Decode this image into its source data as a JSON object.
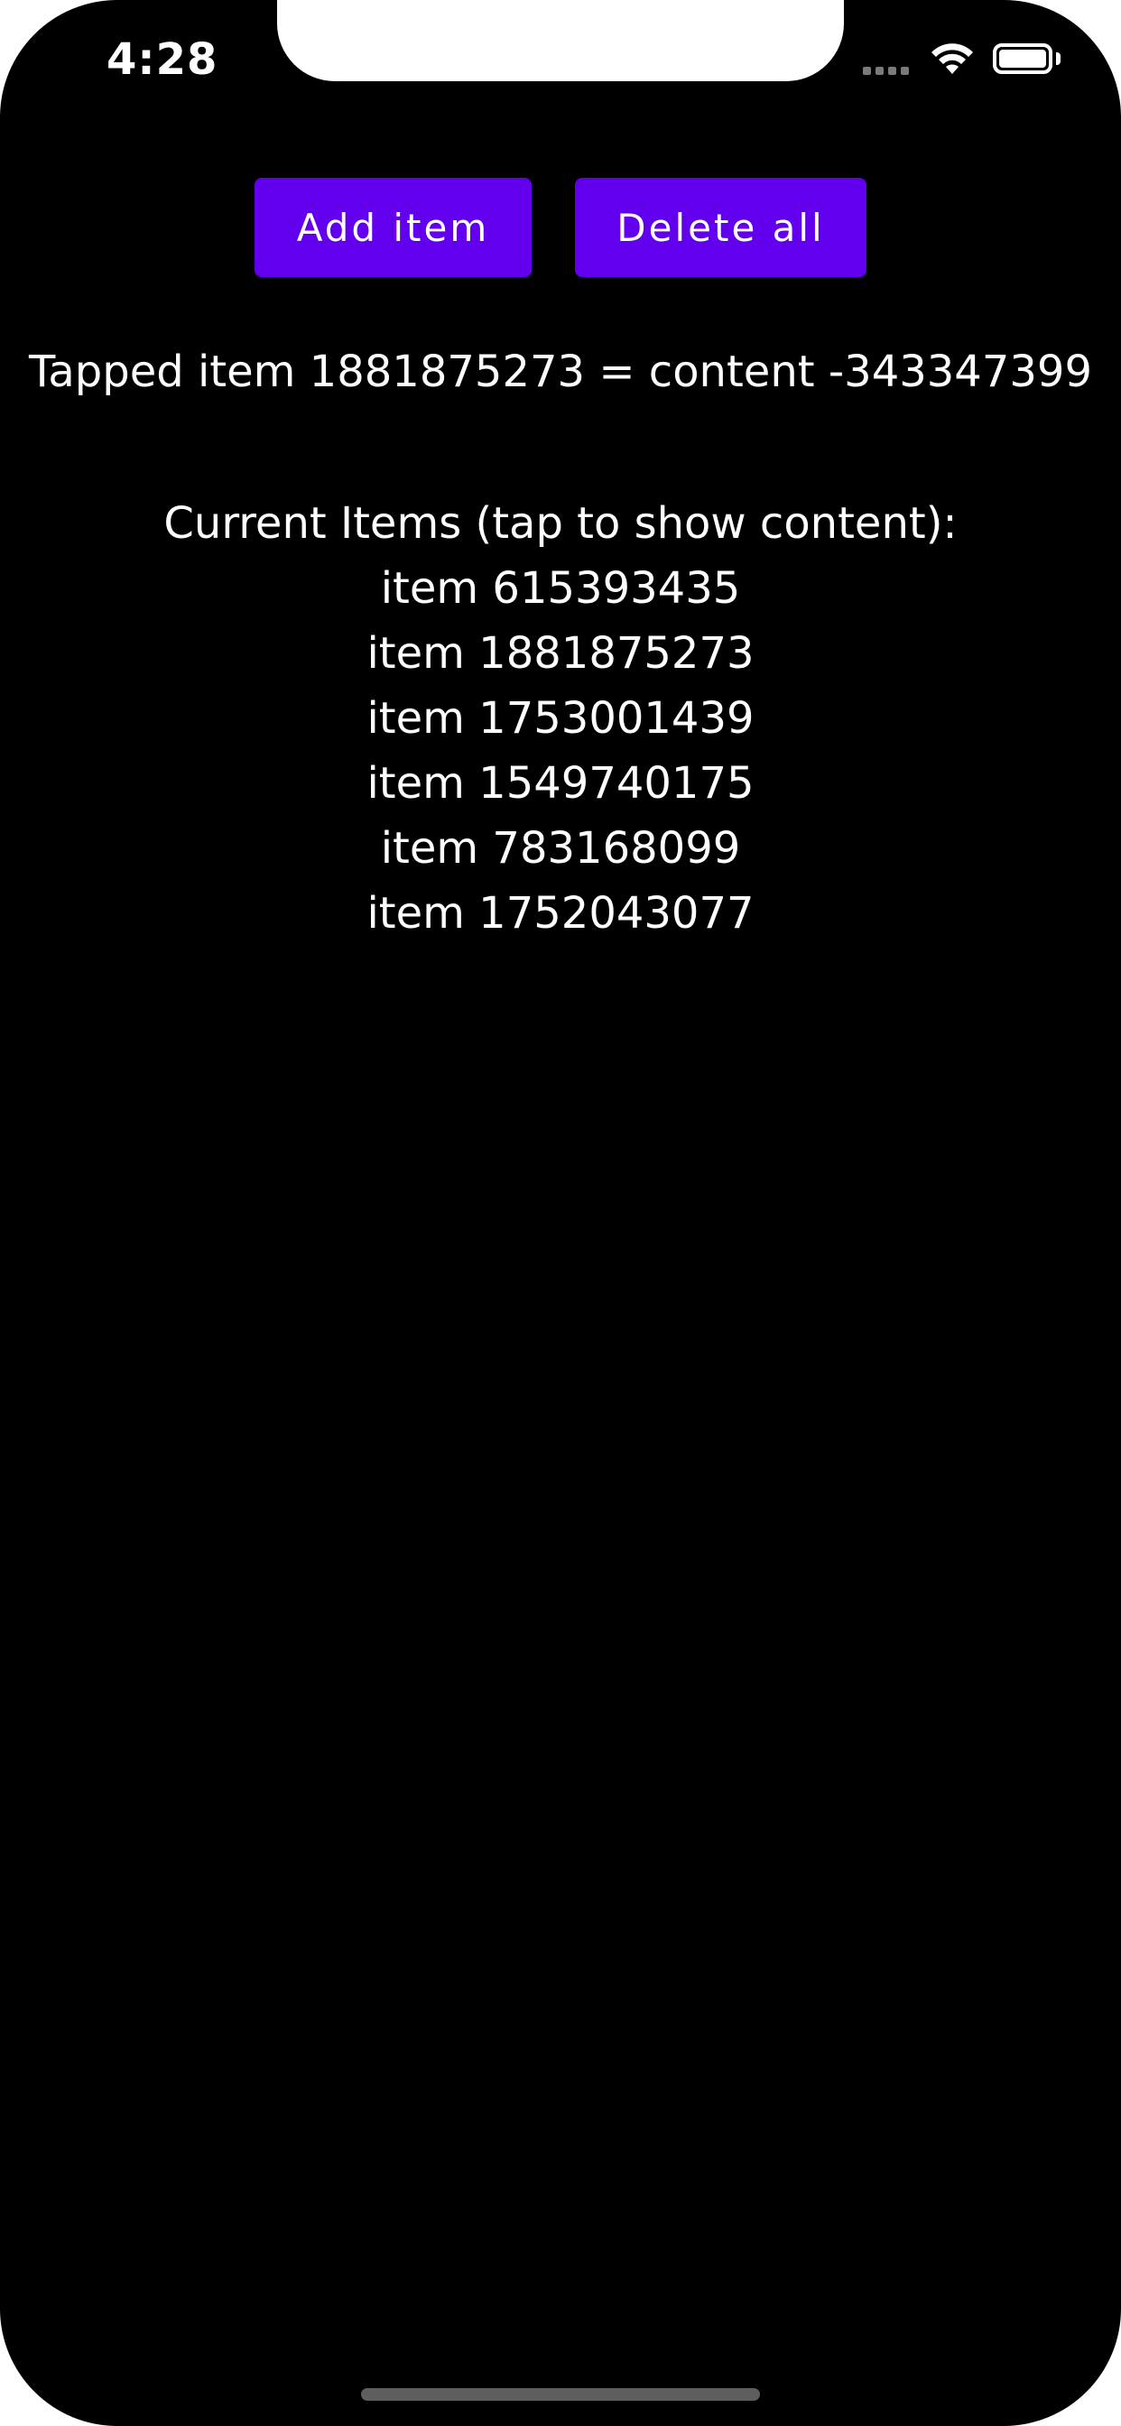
{
  "status_bar": {
    "time": "4:28",
    "icons": [
      "cellular-signal-icon",
      "wifi-icon",
      "battery-icon"
    ]
  },
  "toolbar": {
    "add_label": "Add item",
    "delete_label": "Delete all"
  },
  "tapped_message": "Tapped item 1881875273 = content -343347399",
  "list": {
    "heading": "Current Items (tap to show content):",
    "items": [
      "item 615393435",
      "item 1881875273",
      "item 1753001439",
      "item 1549740175",
      "item 783168099",
      "item 1752043077"
    ]
  },
  "colors": {
    "background": "#000000",
    "button": "#6200ee",
    "text": "#ffffff"
  }
}
